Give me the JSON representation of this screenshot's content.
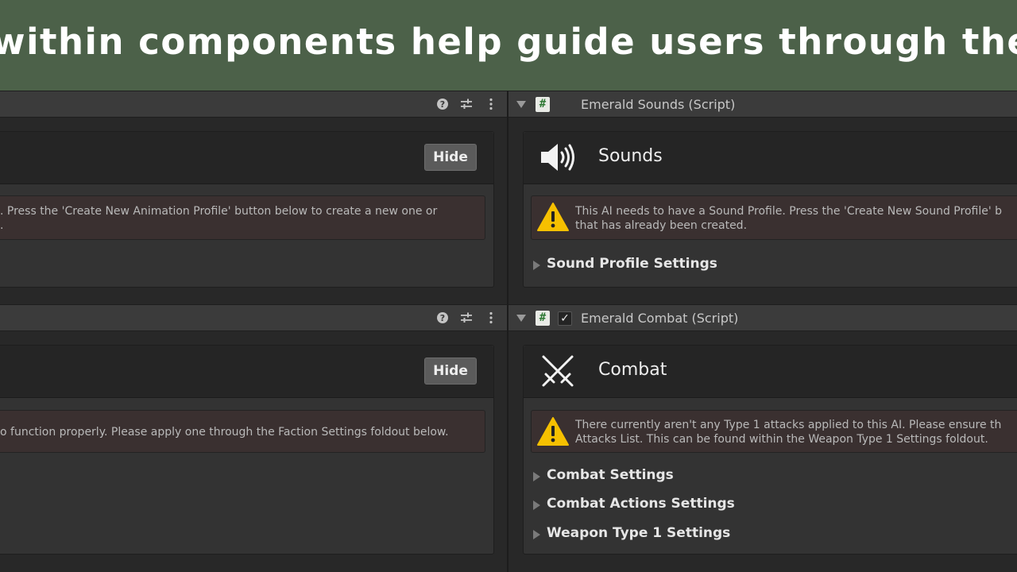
{
  "banner": {
    "text": "within components help guide users through the setup"
  },
  "left": {
    "animation": {
      "hide_label": "Hide",
      "warning_line1": ". Press the 'Create New Animation Profile' button below to create a new one or",
      "warning_line2": "."
    },
    "faction": {
      "hide_label": "Hide",
      "warning_line1": "o function properly. Please apply one through the Faction Settings foldout below."
    }
  },
  "right": {
    "sounds": {
      "header_title": "Emerald Sounds (Script)",
      "title": "Sounds",
      "warning_line1": "This AI needs to have a Sound Profile. Press the 'Create New Sound Profile' b",
      "warning_line2": "that has already been created.",
      "foldouts": [
        "Sound Profile Settings"
      ]
    },
    "combat": {
      "header_title": "Emerald Combat (Script)",
      "enabled_mark": "✓",
      "title": "Combat",
      "warning_line1": "There currently aren't any Type 1 attacks applied to this AI. Please ensure th",
      "warning_line2": "Attacks List. This can be found within the Weapon Type 1 Settings foldout.",
      "foldouts": [
        "Combat Settings",
        "Combat Actions Settings",
        "Weapon Type 1 Settings"
      ]
    }
  },
  "icons": {
    "script": "#",
    "help": "help-icon",
    "presets": "sliders-icon",
    "menu": "kebab-menu-icon",
    "sounds": "speaker-icon",
    "combat": "crossed-swords-icon",
    "warning": "warning-triangle-icon"
  },
  "colors": {
    "banner": "#4c6149",
    "warning_fill": "#f6c000",
    "panel": "#333333",
    "title_bar": "#252525",
    "warning_bg": "#3a3030"
  }
}
